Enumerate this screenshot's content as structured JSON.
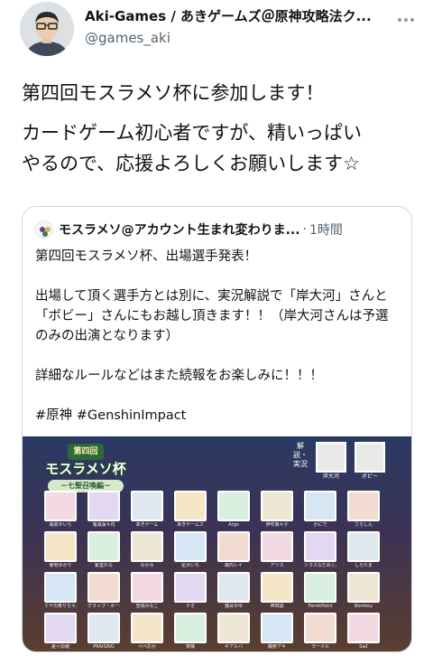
{
  "tweet": {
    "author_name": "Aki-Games / あきゲームズ＠原神攻略法ク...",
    "author_handle": "@games_aki",
    "lines": [
      "第四回モスラメソ杯に参加します！",
      "カードゲーム初心者ですが、精いっぱい",
      "やるので、応援よろしくお願いします☆"
    ]
  },
  "quote": {
    "author_name": "モスラメソ@アカウント生まれ変わりま...",
    "separator": "·",
    "time": "1時間",
    "paragraphs": [
      "第四回モスラメソ杯、出場選手発表！",
      "出場して頂く選手方とは別に、実況解説で「岸大河」さんと「ボビー」さんにもお越し頂きます！！（岸大河さんは予選のみの出演となります）",
      "詳細なルールなどはまた続報をお楽しみに！！！",
      "#原神 #GenshinImpact"
    ],
    "image": {
      "logo_top": "第四回",
      "logo_title": "モスラメソ杯",
      "logo_sub": "－七聖召喚編－",
      "commentary_label": "解説・実況",
      "commentators": [
        "岸大河",
        "ボビー"
      ],
      "players": [
        "風間せいら",
        "鬼滅凜々花",
        "あきゲーム",
        "あきゲームズ",
        "Argo",
        "伊吹萌々子",
        "かにで",
        "さらしん",
        "菊地ゆかり",
        "紫堂れな",
        "みかみ",
        "星月いち",
        "森内レイ",
        "アリス",
        "シラスなだめくん",
        "しらたま",
        "ミヤの祭りちゃん",
        "グラップ・ポーション",
        "雪城みなこ",
        "ナオ",
        "猫耳ゆゆ",
        "神田誠",
        "FerretPoint",
        "Bomkey",
        "夏ヶ原綾",
        "PRAISING",
        "ぺぺおか",
        "斉藤",
        "ギアルバ",
        "藤野アキ",
        "ラーメル",
        "Sa2"
      ]
    }
  }
}
